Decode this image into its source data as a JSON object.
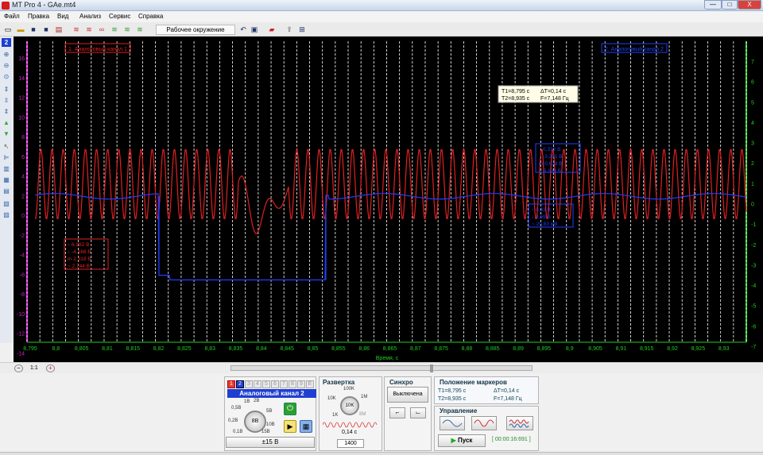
{
  "window": {
    "title": "MT Pro 4 - GAe.mt4",
    "min": "—",
    "max": "□",
    "close": "X"
  },
  "menu": [
    "Файл",
    "Правка",
    "Вид",
    "Анализ",
    "Сервис",
    "Справка"
  ],
  "toolbar": {
    "workspace": "Рабочее окружение"
  },
  "plot": {
    "x_ticks": [
      "8,795",
      "8,8",
      "8,805",
      "8,81",
      "8,815",
      "8,82",
      "8,825",
      "8,83",
      "8,835",
      "8,84",
      "8,845",
      "8,85",
      "8,855",
      "8,86",
      "8,865",
      "8,87",
      "8,875",
      "8,88",
      "8,885",
      "8,89",
      "8,895",
      "8,9",
      "8,905",
      "8,91",
      "8,915",
      "8,92",
      "8,925",
      "8,93"
    ],
    "y_left_ticks": [
      "16",
      "14",
      "12",
      "10",
      "8",
      "6",
      "4",
      "2",
      "0",
      "-2",
      "-4",
      "-6",
      "-8",
      "-10",
      "-12",
      "-14"
    ],
    "y_right_ticks": [
      "7",
      "6",
      "5",
      "4",
      "3",
      "2",
      "1",
      "0",
      "-1",
      "-2",
      "-3",
      "-4",
      "-5",
      "-6",
      "-7"
    ],
    "xlabel": "Время, с",
    "label_ch1": "1. Аналоговый канал 1",
    "label_ch2": "2. Аналоговый канал 2",
    "cursor_box": {
      "t1": "T1=8,795 с",
      "dt": "ΔT=0,14 с",
      "t2": "T2=8,935 с",
      "f": "F=7,148 Гц"
    },
    "stats_red": [
      "↑ 6,962 В",
      "↓ -4,168 В",
      "m  2,318 В",
      "~  2,744 В"
    ],
    "stats_blue1": [
      "↑ 0,332 В",
      "↓ -3,201 В",
      "m  0,628 В",
      "~ 3,193 В"
    ],
    "stats_blue2": [
      "↑ 0,33 В",
      "↓ 4,69 В",
      "~ 20,83 мВ"
    ],
    "colors": {
      "red": "#e02020",
      "blue": "#1e3fff",
      "grid": "#ffffff",
      "axis": "#22cc22"
    }
  },
  "nav": {
    "zoom": "1:1"
  },
  "channel_panel": {
    "tabs": [
      "1",
      "2",
      "3",
      "4",
      "5",
      "6",
      "7",
      "8",
      "9",
      "E"
    ],
    "title": "Аналоговый канал 2",
    "knob_value": "8В",
    "knob_labels": [
      "1В",
      "2В",
      "5В",
      "10В",
      "15В",
      "0,5В",
      "0,2В",
      "0,1В"
    ],
    "range": "±15 В"
  },
  "sweep": {
    "title": "Развертка",
    "knob_value": "10K",
    "labels": [
      "100K",
      "1M",
      "10K",
      "1K",
      "8M"
    ],
    "period": "0,14 с",
    "samples": "1400"
  },
  "sync": {
    "title": "Синхро",
    "mode": "Выключена"
  },
  "markers": {
    "title": "Положение маркеров",
    "t1": "T1=8,795 с",
    "dt": "ΔT=0,14 с",
    "t2": "T2=8,935 с",
    "f": "F=7,148 Гц"
  },
  "control": {
    "title": "Управление",
    "start": "Пуск",
    "elapsed": "[ 00:00:16:691 ]"
  }
}
